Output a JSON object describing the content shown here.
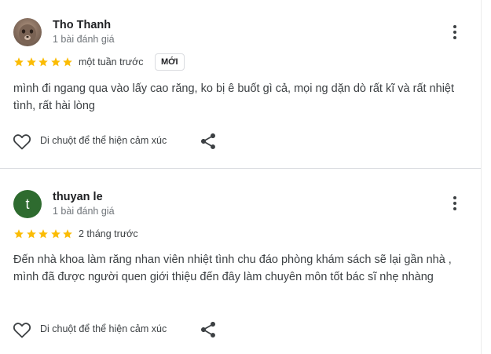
{
  "colors": {
    "star": "#fbbc04",
    "divider": "#dadce0",
    "avatar_t": "#2e6b2f"
  },
  "reviews": [
    {
      "author": "Tho Thanh",
      "review_count": "1 bài đánh giá",
      "rating": 5,
      "time": "một tuần trước",
      "badge": "MỚI",
      "text": "mình đi ngang qua vào lấy cao răng, ko bị ê buốt gì cả, mọi ng dặn dò rất kĩ và rất nhiệt tình, rất hài lòng",
      "hover_label": "Di chuột để thể hiện cảm xúc"
    },
    {
      "author": "thuyan le",
      "avatar_letter": "t",
      "review_count": "1 bài đánh giá",
      "rating": 5,
      "time": "2 tháng trước",
      "text": "Đến nhà khoa làm răng nhan viên nhiệt tình chu đáo phòng khám sách sẽ lại gần nhà , mình đã được người quen giới thiệu đến đây làm chuyên môn tốt bác sĩ nhẹ nhàng",
      "hover_label": "Di chuột để thể hiện cảm xúc"
    }
  ]
}
